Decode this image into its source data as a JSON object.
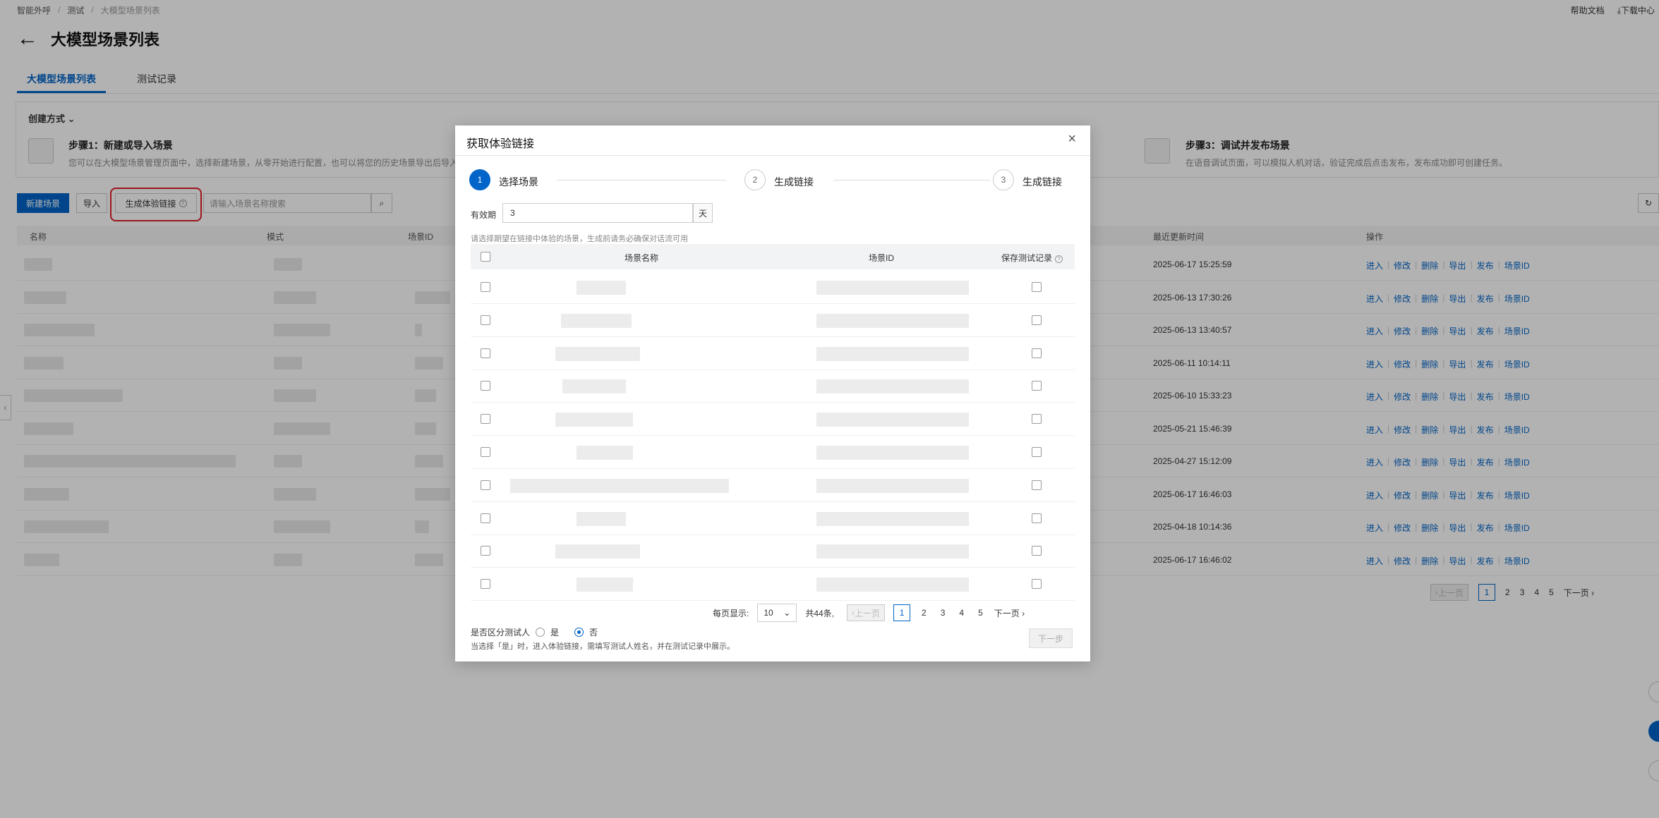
{
  "breadcrumb": [
    "智能外呼",
    "测试",
    "大模型场景列表"
  ],
  "topright": {
    "help": "帮助文档",
    "download": "下载中心"
  },
  "page_title": "大模型场景列表",
  "tabs": [
    {
      "label": "大模型场景列表",
      "active": true
    },
    {
      "label": "测试记录",
      "active": false
    }
  ],
  "create": {
    "head": "创建方式",
    "step1_title": "步骤1：新建或导入场景",
    "step1_desc": "您可以在大模型场景管理页面中，选择新建场景，从零开始进行配置，也可以将您的历史场景导出后导入，快速使用",
    "step3_title": "步骤3：调试并发布场景",
    "step3_desc": "在语音调试页面，可以模拟人机对话，验证完成后点击发布，发布成功即可创建任务。"
  },
  "toolbar": {
    "new_scene": "新建场景",
    "import": "导入",
    "gen_link": "生成体验链接",
    "search_placeholder": "请输入场景名称搜索"
  },
  "table": {
    "headers": {
      "name": "名称",
      "mode": "模式",
      "scene_id": "场景ID",
      "updated": "最近更新时间",
      "ops": "操作"
    },
    "ops": [
      "进入",
      "修改",
      "删除",
      "导出",
      "发布",
      "场景ID"
    ],
    "times": [
      "2025-06-17 15:25:59",
      "2025-06-13 17:30:26",
      "2025-06-13 13:40:57",
      "2025-06-11 10:14:11",
      "2025-06-10 15:33:23",
      "2025-05-21 15:46:39",
      "2025-04-27 15:12:09",
      "2025-06-17 16:46:03",
      "2025-04-18 10:14:36",
      "2025-06-17 16:46:02"
    ]
  },
  "bg_pager": {
    "prev": "上一页",
    "pages": [
      "1",
      "2",
      "3",
      "4",
      "5"
    ],
    "next": "下一页"
  },
  "modal": {
    "title": "获取体验链接",
    "close": "×",
    "steps": [
      {
        "num": "1",
        "label": "选择场景",
        "active": true
      },
      {
        "num": "2",
        "label": "生成链接",
        "active": false
      },
      {
        "num": "3",
        "label": "生成链接",
        "active": false
      }
    ],
    "validity_label": "有效期",
    "validity_value": "3",
    "validity_unit": "天",
    "hint": "请选择期望在链接中体验的场景，生成前请务必确保对话流可用",
    "headers": {
      "name": "场景名称",
      "scene_id": "场景ID",
      "save_record": "保存测试记录"
    },
    "row_count": 10,
    "pager": {
      "per_page_label": "每页显示:",
      "per_page": "10",
      "total": "共44条,",
      "prev": "上一页",
      "pages": [
        "1",
        "2",
        "3",
        "4",
        "5"
      ],
      "next": "下一页"
    },
    "distinguish_label": "是否区分测试人",
    "yes": "是",
    "no": "否",
    "selected": "no",
    "note": "当选择「是」时，进入体验链接，需填写测试人姓名，并在测试记录中展示。",
    "next_button": "下一步"
  }
}
